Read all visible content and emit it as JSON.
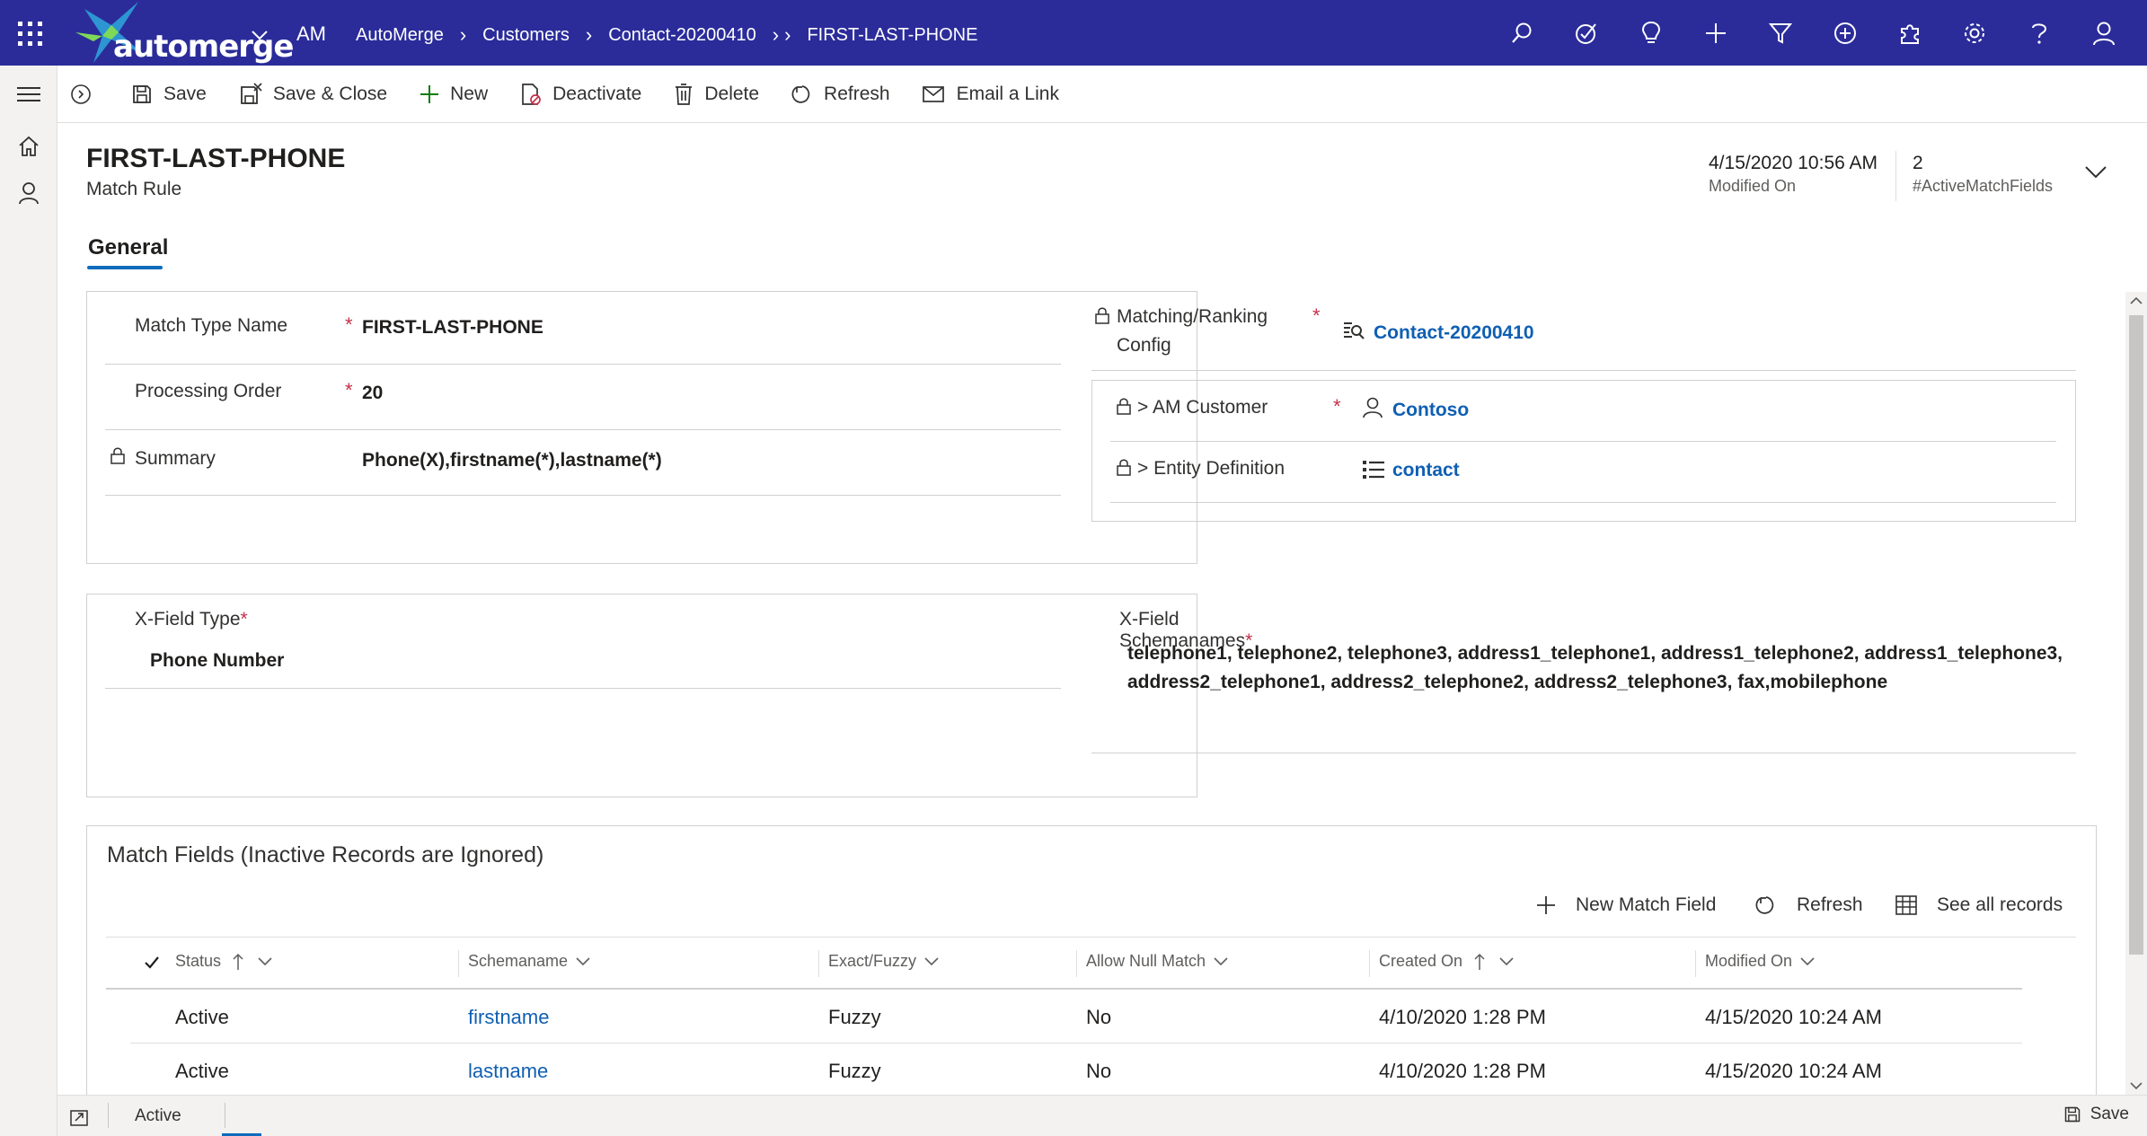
{
  "topbar": {
    "brand": "automerge",
    "app_code": "AM",
    "breadcrumbs": [
      "AutoMerge",
      "Customers",
      "Contact-20200410",
      "FIRST-LAST-PHONE"
    ],
    "icons": [
      "search-icon",
      "task-icon",
      "lightbulb-icon",
      "plus-icon",
      "filter-icon",
      "add-circle-icon",
      "puzzle-icon",
      "gear-icon",
      "help-icon",
      "user-icon"
    ]
  },
  "commands": {
    "save": "Save",
    "save_close": "Save & Close",
    "new": "New",
    "deactivate": "Deactivate",
    "delete": "Delete",
    "refresh": "Refresh",
    "email_link": "Email a Link"
  },
  "header": {
    "title": "FIRST-LAST-PHONE",
    "subtitle": "Match Rule",
    "modified_on_value": "4/15/2020 10:56 AM",
    "modified_on_label": "Modified On",
    "active_fields_value": "2",
    "active_fields_label": "#ActiveMatchFields"
  },
  "tabs": {
    "general": "General"
  },
  "general": {
    "match_type_name_label": "Match Type Name",
    "match_type_name_value": "FIRST-LAST-PHONE",
    "processing_order_label": "Processing Order",
    "processing_order_value": "20",
    "summary_label": "Summary",
    "summary_value": "Phone(X),firstname(*),lastname(*)",
    "config_label_1": "Matching/Ranking",
    "config_label_2": "Config",
    "config_value": "Contact-20200410",
    "customer_label": "> AM Customer",
    "customer_value": "Contoso",
    "entity_label": "> Entity Definition",
    "entity_value": "contact",
    "required_mark": "*"
  },
  "xfield": {
    "type_label": "X-Field Type",
    "type_value": "Phone Number",
    "schemanames_label": "X-Field Schemanames",
    "schemanames_line1": "telephone1, telephone2, telephone3, address1_telephone1, address1_telephone2, address1_telephone3,",
    "schemanames_line2": "address2_telephone1, address2_telephone2, address2_telephone3, fax,mobilephone"
  },
  "match_fields": {
    "title": "Match Fields (Inactive Records are Ignored)",
    "new_label": "New Match Field",
    "refresh_label": "Refresh",
    "see_all_label": "See all records",
    "columns": [
      "Status",
      "Schemaname",
      "Exact/Fuzzy",
      "Allow Null Match",
      "Created On",
      "Modified On"
    ],
    "rows": [
      [
        "Active",
        "firstname",
        "Fuzzy",
        "No",
        "4/10/2020 1:28 PM",
        "4/15/2020 10:24 AM"
      ],
      [
        "Active",
        "lastname",
        "Fuzzy",
        "No",
        "4/10/2020 1:28 PM",
        "4/15/2020 10:24 AM"
      ]
    ]
  },
  "statusbar": {
    "status": "Active",
    "save_label": "Save"
  },
  "colors": {
    "nav_bg": "#2b2c9a",
    "link": "#0f5fb3",
    "required": "#c4314b",
    "accent": "#0f6cbd"
  }
}
